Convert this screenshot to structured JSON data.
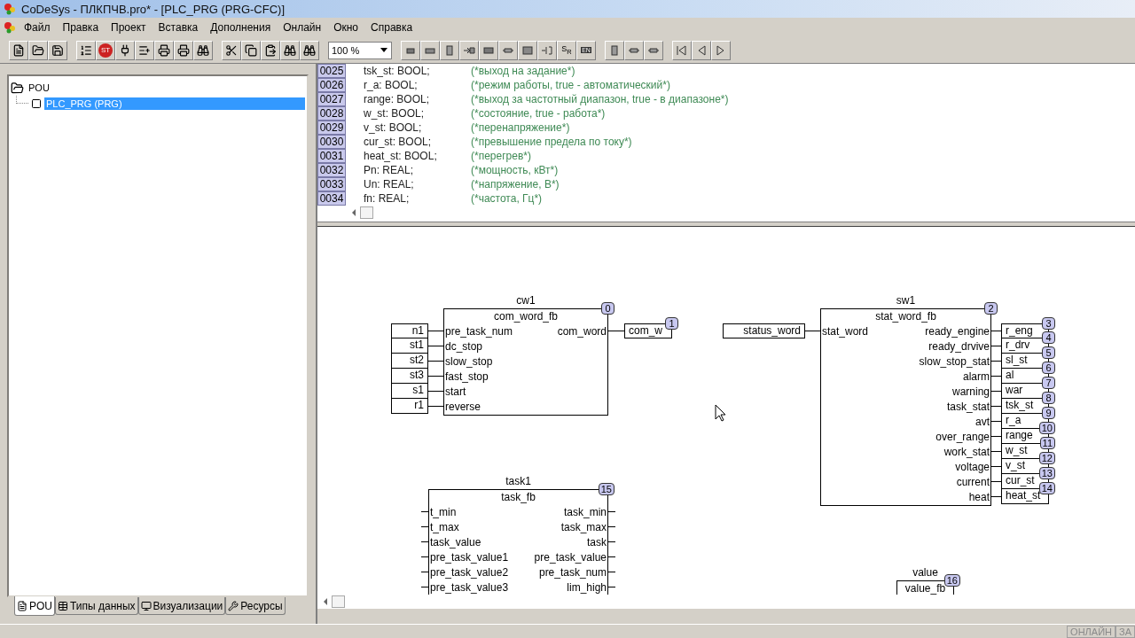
{
  "window": {
    "title": "CoDeSys - ПЛКПЧВ.pro* - [PLC_PRG (PRG-CFC)]"
  },
  "menu": [
    "Файл",
    "Правка",
    "Проект",
    "Вставка",
    "Дополнения",
    "Онлайн",
    "Окно",
    "Справка"
  ],
  "toolbar": {
    "stop_label": "ST",
    "zoom": "100 %",
    "sr_label": "S$_{R}$",
    "en_label": "EN"
  },
  "tree": [
    {
      "label": "POU",
      "expanded": true,
      "selected": false,
      "children": [
        {
          "label": "PLC_PRG (PRG)",
          "selected": true
        }
      ]
    }
  ],
  "tabs": [
    {
      "label": "POU",
      "selected": true
    },
    {
      "label": "Типы данных",
      "selected": false
    },
    {
      "label": "Визуализации",
      "selected": false
    },
    {
      "label": "Ресурсы",
      "selected": false
    }
  ],
  "declarations": [
    {
      "line": "0025",
      "code": "tsk_st: BOOL;",
      "comment": "(*выход на задание*)"
    },
    {
      "line": "0026",
      "code": "r_a: BOOL;",
      "comment": "(*режим работы, true - автоматический*)"
    },
    {
      "line": "0027",
      "code": "range: BOOL;",
      "comment": "(*выход за частотный диапазон, true - в диапазоне*)"
    },
    {
      "line": "0028",
      "code": "w_st: BOOL;",
      "comment": "(*состояние, true - работа*)"
    },
    {
      "line": "0029",
      "code": "v_st: BOOL;",
      "comment": "(*перенапряжение*)"
    },
    {
      "line": "0030",
      "code": "cur_st: BOOL;",
      "comment": "(*превышение предела по току*)"
    },
    {
      "line": "0031",
      "code": "heat_st: BOOL;",
      "comment": "(*перегрев*)"
    },
    {
      "line": "0032",
      "code": "Pn: REAL;",
      "comment": "(*мощность, кВт*)"
    },
    {
      "line": "0033",
      "code": "Un: REAL;",
      "comment": "(*напряжение, В*)"
    },
    {
      "line": "0034",
      "code": "fn: REAL;",
      "comment": "(*частота, Гц*)"
    }
  ],
  "diagram": {
    "blocks": [
      {
        "instance": "cw1",
        "type": "com_word_fb",
        "order": "0",
        "inputs": [
          {
            "pin": "pre_task_num",
            "var": "n1"
          },
          {
            "pin": "dc_stop",
            "var": "st1"
          },
          {
            "pin": "slow_stop",
            "var": "st2"
          },
          {
            "pin": "fast_stop",
            "var": "st3"
          },
          {
            "pin": "start",
            "var": "s1"
          },
          {
            "pin": "reverse",
            "var": "r1"
          }
        ],
        "outputs": [
          {
            "pin": "com_word",
            "var": "com_w",
            "order": "1"
          }
        ]
      },
      {
        "instance": "sw1",
        "type": "stat_word_fb",
        "order": "2",
        "inputs": [
          {
            "pin": "stat_word",
            "var": "status_word"
          }
        ],
        "outputs": [
          {
            "pin": "ready_engine",
            "var": "r_eng",
            "order": "3"
          },
          {
            "pin": "ready_drvive",
            "var": "r_drv",
            "order": "4"
          },
          {
            "pin": "slow_stop_stat",
            "var": "sl_st",
            "order": "5"
          },
          {
            "pin": "alarm",
            "var": "al",
            "order": "6"
          },
          {
            "pin": "warning",
            "var": "war",
            "order": "7"
          },
          {
            "pin": "task_stat",
            "var": "tsk_st",
            "order": "8"
          },
          {
            "pin": "avt",
            "var": "r_a",
            "order": "9"
          },
          {
            "pin": "over_range",
            "var": "range",
            "order": "10"
          },
          {
            "pin": "work_stat",
            "var": "w_st",
            "order": "11"
          },
          {
            "pin": "voltage",
            "var": "v_st",
            "order": "12"
          },
          {
            "pin": "current",
            "var": "cur_st",
            "order": "13"
          },
          {
            "pin": "heat",
            "var": "heat_st",
            "order": "14"
          }
        ]
      },
      {
        "instance": "task1",
        "type": "task_fb",
        "order": "15",
        "inputs": [
          {
            "pin": "t_min"
          },
          {
            "pin": "t_max"
          },
          {
            "pin": "task_value"
          },
          {
            "pin": "pre_task_value1"
          },
          {
            "pin": "pre_task_value2"
          },
          {
            "pin": "pre_task_value3"
          }
        ],
        "outputs": [
          {
            "pin": "task_min"
          },
          {
            "pin": "task_max"
          },
          {
            "pin": "task"
          },
          {
            "pin": "pre_task_value"
          },
          {
            "pin": "pre_task_num"
          },
          {
            "pin": "lim_high"
          }
        ]
      },
      {
        "instance": "value",
        "type": "value_fb",
        "order": "16"
      }
    ]
  },
  "status_bar": [
    "ОНЛАЙН",
    "ЗА"
  ]
}
